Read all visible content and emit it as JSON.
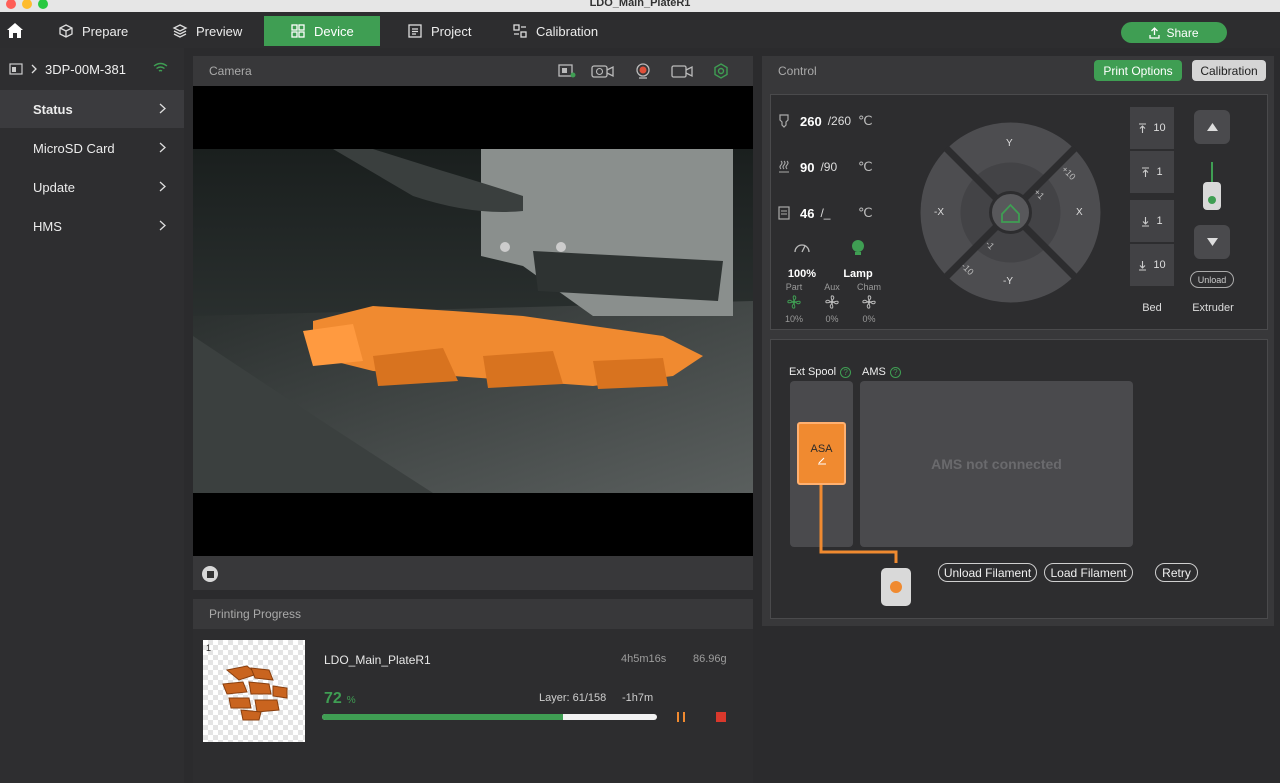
{
  "window": {
    "title": "LDO_Main_PlateR1"
  },
  "nav": {
    "tabs": [
      {
        "label": "Prepare",
        "icon": "cube-icon"
      },
      {
        "label": "Preview",
        "icon": "layers-icon"
      },
      {
        "label": "Device",
        "icon": "device-icon",
        "active": true
      },
      {
        "label": "Project",
        "icon": "project-icon"
      },
      {
        "label": "Calibration",
        "icon": "calibration-icon"
      }
    ],
    "share_label": "Share"
  },
  "sidebar": {
    "printer_name": "3DP-00M-381",
    "items": [
      {
        "label": "Status",
        "active": true
      },
      {
        "label": "MicroSD Card"
      },
      {
        "label": "Update"
      },
      {
        "label": "HMS"
      }
    ]
  },
  "camera": {
    "title": "Camera",
    "icons": [
      "sd-record-icon",
      "timelapse-icon",
      "webcam-icon",
      "video-icon",
      "settings-icon"
    ]
  },
  "progress": {
    "title": "Printing Progress",
    "plate_number": "1",
    "file_name": "LDO_Main_PlateR1",
    "duration": "4h5m16s",
    "weight": "86.96g",
    "percent": "72",
    "percent_unit": "%",
    "percent_value": 0.72,
    "layer": "Layer: 61/158",
    "remaining": "-1h7m"
  },
  "control": {
    "title": "Control",
    "print_options_label": "Print Options",
    "calibration_label": "Calibration",
    "nozzle": {
      "current": "260",
      "target": "/260",
      "unit": "℃"
    },
    "bed": {
      "current": "90",
      "target": "/90",
      "unit": "℃"
    },
    "chamber": {
      "current": "46",
      "target": "/_",
      "unit": "℃"
    },
    "speed": "100%",
    "lamp": "Lamp",
    "fans": [
      {
        "label": "Part",
        "value": "10%"
      },
      {
        "label": "Aux",
        "value": "0%"
      },
      {
        "label": "Cham",
        "value": "0%"
      }
    ],
    "jog": {
      "y_plus": "Y",
      "y_minus": "-Y",
      "x_plus": "X",
      "x_minus": "-X",
      "p10": "+10",
      "p1": "+1",
      "m1": "-1",
      "m10": "-10"
    },
    "bed_buttons": [
      "10",
      "1",
      "1",
      "10"
    ],
    "bed_label": "Bed",
    "extruder_label": "Extruder",
    "unload_small": "Unload"
  },
  "ams": {
    "ext_spool_label": "Ext Spool",
    "ams_label": "AMS",
    "help_glyph": "?",
    "spool_material": "ASA",
    "spool_color": "#f08a30",
    "not_connected": "AMS not connected",
    "unload_filament": "Unload Filament",
    "load_filament": "Load Filament",
    "retry": "Retry"
  },
  "colors": {
    "accent": "#3f9e53",
    "stop": "#d9382c",
    "pause": "#f08a30"
  }
}
